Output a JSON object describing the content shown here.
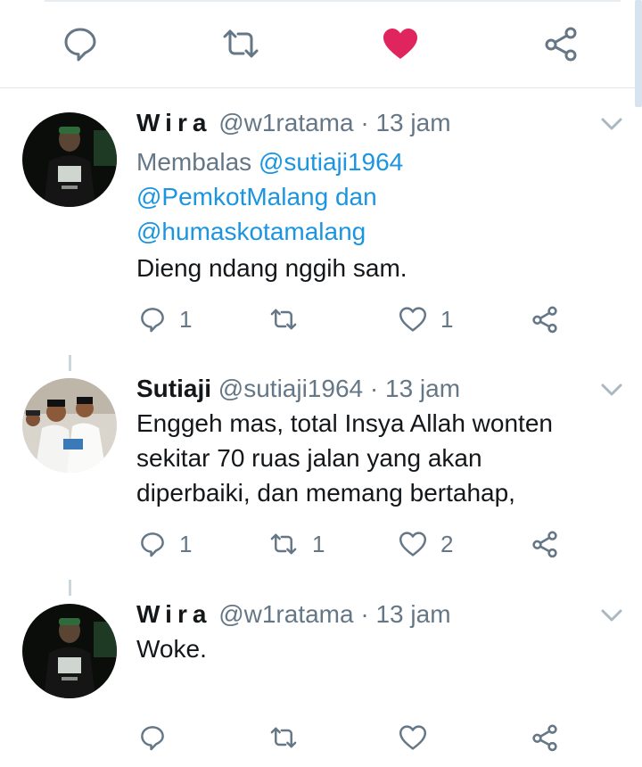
{
  "tweets": [
    {
      "name": "Wira",
      "handle": "@w1ratama",
      "time": "13 jam",
      "reply_prefix": "Membalas",
      "reply_line1": "@sutiaji1964",
      "reply_line2_mention": "@PemkotMalang",
      "reply_line2_and": "dan",
      "reply_line3": "@humaskotamalang",
      "text_lines": [
        "Dieng ndang nggih sam."
      ],
      "reply_count": "1",
      "retweet_count": "",
      "like_count": "1"
    },
    {
      "name": "Sutiaji",
      "handle": "@sutiaji1964",
      "time": "13 jam",
      "text_lines": [
        "Enggeh mas, total Insya Allah wonten",
        "sekitar 70 ruas jalan yang akan",
        "diperbaiki, dan memang bertahap,"
      ],
      "reply_count": "1",
      "retweet_count": "1",
      "like_count": "2"
    },
    {
      "name": "Wira",
      "handle": "@w1ratama",
      "time": "13 jam",
      "text_lines": [
        "Woke."
      ],
      "reply_count": "",
      "retweet_count": "",
      "like_count": ""
    }
  ],
  "separator": "·",
  "colors": {
    "like_active": "#e0245e",
    "link": "#1b95e0",
    "muted": "#657786",
    "text": "#14171a"
  },
  "icons": [
    "reply-icon",
    "retweet-icon",
    "like-icon",
    "share-icon",
    "caret-down-icon"
  ]
}
